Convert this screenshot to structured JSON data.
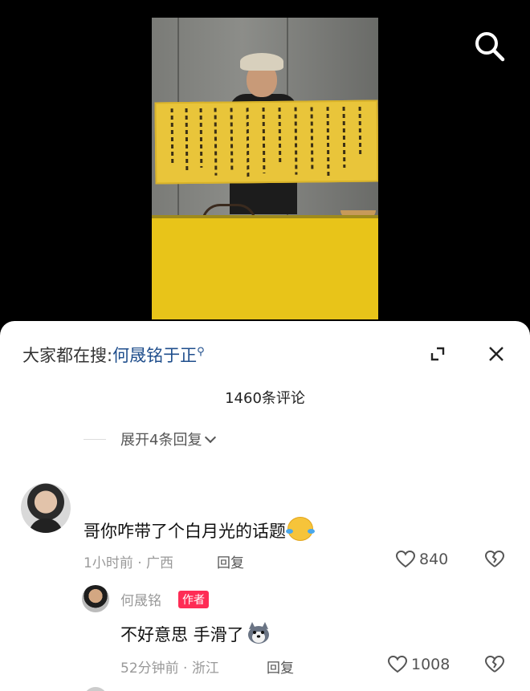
{
  "video": {
    "search_icon": "search-icon",
    "scene": "calligraphy-scroll-photo"
  },
  "sheet": {
    "hot_search_prefix": "大家都在搜:",
    "hot_search_term": "何晟铭于正",
    "hot_search_icon": "search-mini-icon",
    "comment_count": "1460条评论",
    "expand_replies": "展开4条回复",
    "colors": {
      "link": "#1f4e8c",
      "author_badge": "#fe2c55"
    }
  },
  "comments": [
    {
      "username": "",
      "text": "哥你咋带了个白月光的话题",
      "emoji": "laughing-tears-emoji",
      "meta": "1小时前 · 广西",
      "reply_label": "回复",
      "likes": "840"
    },
    {
      "username": "何晟铭",
      "badge": "作者",
      "text": "不好意思  手滑了",
      "sticker": "husky-dog-sticker",
      "meta": "52分钟前 · 浙江",
      "reply_label": "回复",
      "likes": "1008"
    }
  ]
}
